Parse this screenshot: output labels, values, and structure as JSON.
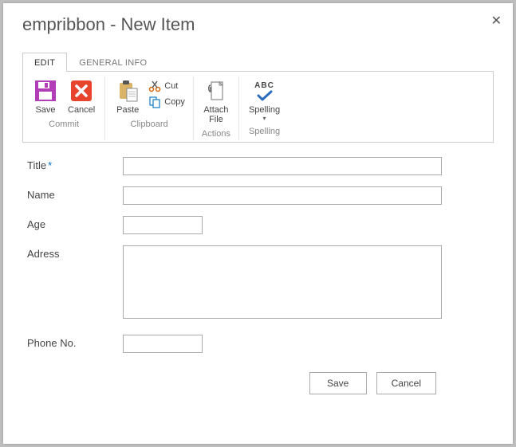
{
  "dialog": {
    "title": "empribbon - New Item"
  },
  "tabs": {
    "edit": "EDIT",
    "general": "GENERAL INFO"
  },
  "ribbon": {
    "save": "Save",
    "cancel": "Cancel",
    "paste": "Paste",
    "cut": "Cut",
    "copy": "Copy",
    "attach_file": "Attach\nFile",
    "spelling": "Spelling",
    "group_commit": "Commit",
    "group_clipboard": "Clipboard",
    "group_actions": "Actions",
    "group_spelling": "Spelling",
    "abc": "ABC"
  },
  "form": {
    "title_label": "Title",
    "name_label": "Name",
    "age_label": "Age",
    "address_label": "Adress",
    "phone_label": "Phone No.",
    "title_value": "",
    "name_value": "",
    "age_value": "",
    "address_value": "",
    "phone_value": ""
  },
  "buttons": {
    "save": "Save",
    "cancel": "Cancel"
  }
}
